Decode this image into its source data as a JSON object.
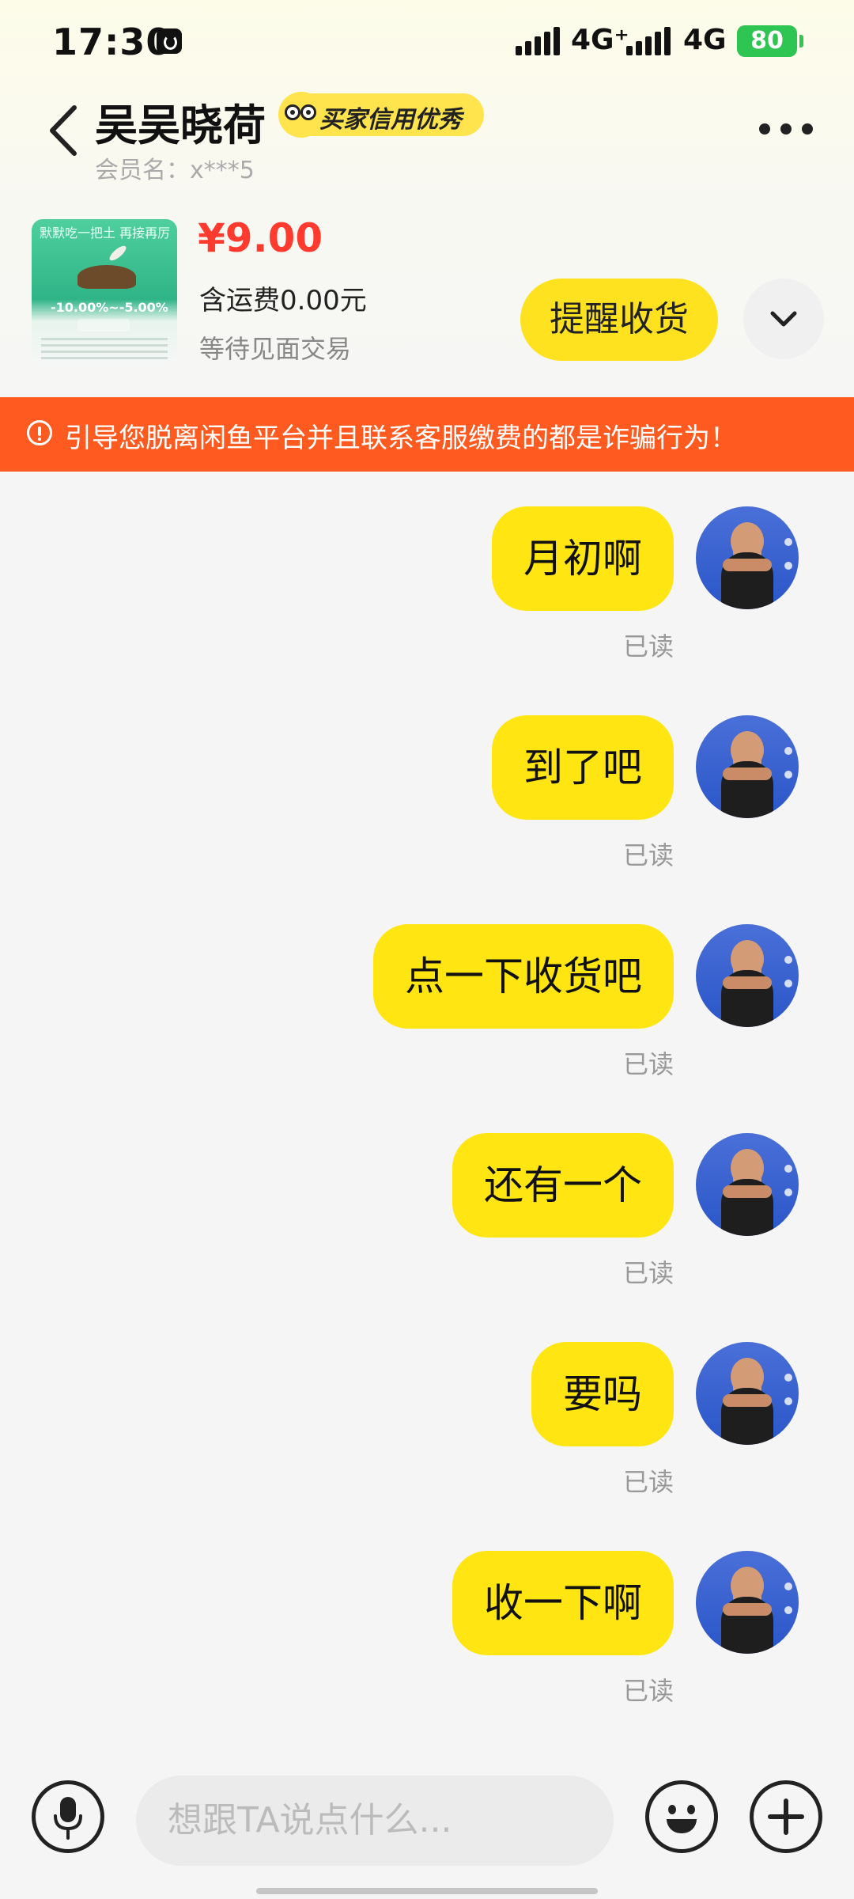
{
  "status_bar": {
    "time": "17:30",
    "network_1": "4G⁺",
    "network_2": "4G",
    "battery": "80",
    "icons": [
      "tiktok-icon",
      "signal-icon",
      "signal-icon",
      "battery-charging-icon"
    ]
  },
  "header": {
    "title": "吴吴晓荷",
    "credit_badge": "买家信用优秀",
    "member_label": "会员名：x***5",
    "icons": [
      "back-arrow-icon",
      "more-icon"
    ]
  },
  "product": {
    "thumb_top_text": "默默吃一把土 再接再厉",
    "thumb_percent": "-10.00%~-5.00%",
    "price": "¥9.00",
    "shipping": "含运费0.00元",
    "status": "等待见面交易",
    "remind_button": "提醒收货",
    "expand_icon": "chevron-down-icon"
  },
  "warning": {
    "text": "引导您脱离闲鱼平台并且联系客服缴费的都是诈骗行为！",
    "icon": "alert-circle-icon"
  },
  "messages": [
    {
      "text": "月初啊",
      "status": "已读"
    },
    {
      "text": "到了吧",
      "status": "已读"
    },
    {
      "text": "点一下收货吧",
      "status": "已读"
    },
    {
      "text": "还有一个",
      "status": "已读"
    },
    {
      "text": "要吗",
      "status": "已读"
    },
    {
      "text": "收一下啊",
      "status": "已读"
    }
  ],
  "input": {
    "placeholder": "想跟TA说点什么...",
    "icons": [
      "microphone-icon",
      "emoji-icon",
      "plus-icon"
    ]
  },
  "colors": {
    "accent_yellow": "#ffe511",
    "price_red": "#ff3b30",
    "warning_orange": "#ff5a1f",
    "battery_green": "#2fc552"
  }
}
